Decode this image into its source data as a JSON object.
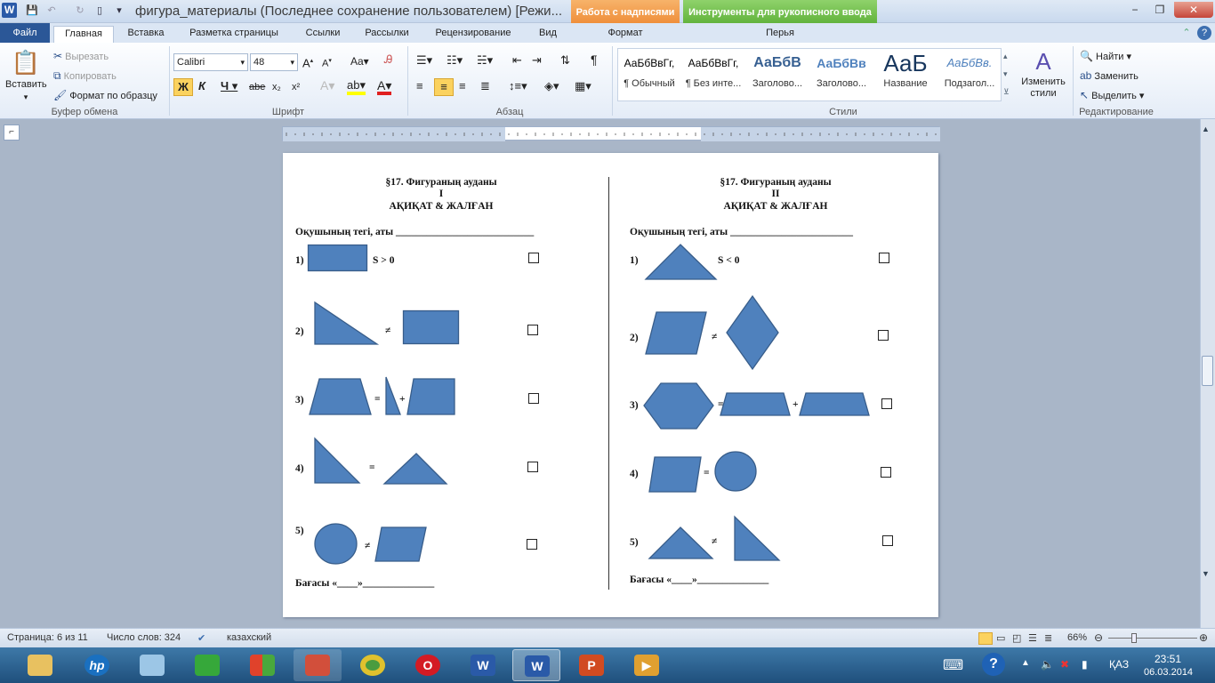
{
  "window": {
    "title": "фигура_материалы (Последнее сохранение пользователем) [Режи...",
    "context_tab_text": "Работа с надписями",
    "context_tab_ink": "Инструменты для рукописного ввода",
    "min": "−",
    "max": "❐",
    "close": "✕"
  },
  "tabs": {
    "file": "Файл",
    "home": "Главная",
    "insert": "Вставка",
    "layout": "Разметка страницы",
    "refs": "Ссылки",
    "mailings": "Рассылки",
    "review": "Рецензирование",
    "view": "Вид",
    "format": "Формат",
    "pens": "Перья"
  },
  "ribbon": {
    "clipboard": {
      "paste": "Вставить",
      "cut": "Вырезать",
      "copy": "Копировать",
      "painter": "Формат по образцу",
      "label": "Буфер обмена"
    },
    "font": {
      "name": "Calibri",
      "size": "48",
      "label": "Шрифт"
    },
    "paragraph": {
      "label": "Абзац"
    },
    "styles": {
      "label": "Стили",
      "items": [
        {
          "sample": "АаБбВвГг,",
          "name": "¶ Обычный"
        },
        {
          "sample": "АаБбВвГг,",
          "name": "¶ Без инте..."
        },
        {
          "sample": "АаБбВ",
          "name": "Заголово..."
        },
        {
          "sample": "АаБбВв",
          "name": "Заголово..."
        },
        {
          "sample": "АаБ",
          "name": "Название"
        },
        {
          "sample": "АаБбВв.",
          "name": "Подзагол..."
        }
      ],
      "change": "Изменить стили"
    },
    "editing": {
      "find": "Найти",
      "replace": "Заменить",
      "select": "Выделить",
      "label": "Редактирование"
    }
  },
  "worksheet": {
    "left": {
      "heading": "§17. Фигураның ауданы",
      "variant": "І",
      "subtitle": "АҚИҚАТ & ЖАЛҒАН",
      "student": "Оқушының тегі, аты ___________________________",
      "items": [
        {
          "num": "1)",
          "expr": "S > 0"
        },
        {
          "num": "2)",
          "op": "≠"
        },
        {
          "num": "3)",
          "op1": "=",
          "op2": "+"
        },
        {
          "num": "4)",
          "op": "="
        },
        {
          "num": "5)",
          "op": "≠"
        }
      ],
      "grade": "Бағасы «____»______________"
    },
    "right": {
      "heading": "§17. Фигураның ауданы",
      "variant": "ІІ",
      "subtitle": "АҚИҚАТ & ЖАЛҒАН",
      "student": "Оқушының тегі, аты ________________________",
      "items": [
        {
          "num": "1)",
          "expr": "S < 0"
        },
        {
          "num": "2)",
          "op": "≠"
        },
        {
          "num": "3)",
          "op1": "=",
          "op2": "+"
        },
        {
          "num": "4)",
          "op": "="
        },
        {
          "num": "5)",
          "op": "≠"
        }
      ],
      "grade": "Бағасы «____»______________"
    }
  },
  "status": {
    "page": "Страница: 6 из 11",
    "words": "Число слов: 324",
    "lang": "казахский",
    "zoom": "66%"
  },
  "taskbar": {
    "lang": "ҚАЗ",
    "time": "23:51",
    "date": "06.03.2014"
  }
}
